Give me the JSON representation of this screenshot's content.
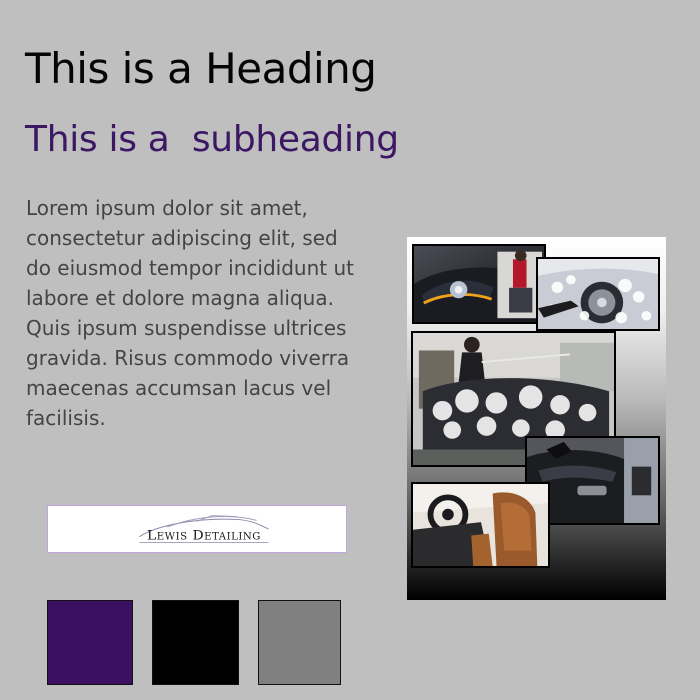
{
  "heading": "This is a Heading",
  "subheading": "This is a  subheading",
  "body_text": "Lorem ipsum dolor sit amet, consectetur adipiscing elit, sed do eiusmod tempor incididunt ut labore et dolore magna aliqua. Quis ipsum suspendisse ultrices gravida. Risus commodo viverra maecenas accumsan lacus vel facilisis.",
  "logo": {
    "text": "Lewis Detailing"
  },
  "palette": [
    {
      "name": "purple",
      "color": "#3b1062"
    },
    {
      "name": "black",
      "color": "#000000"
    },
    {
      "name": "gray",
      "color": "#808080"
    }
  ],
  "collage": {
    "photos": [
      "car-headlight-photo",
      "car-wash-foam-photo",
      "pressure-washing-car-photo",
      "car-door-interior-photo",
      "car-interior-seats-photo"
    ]
  }
}
